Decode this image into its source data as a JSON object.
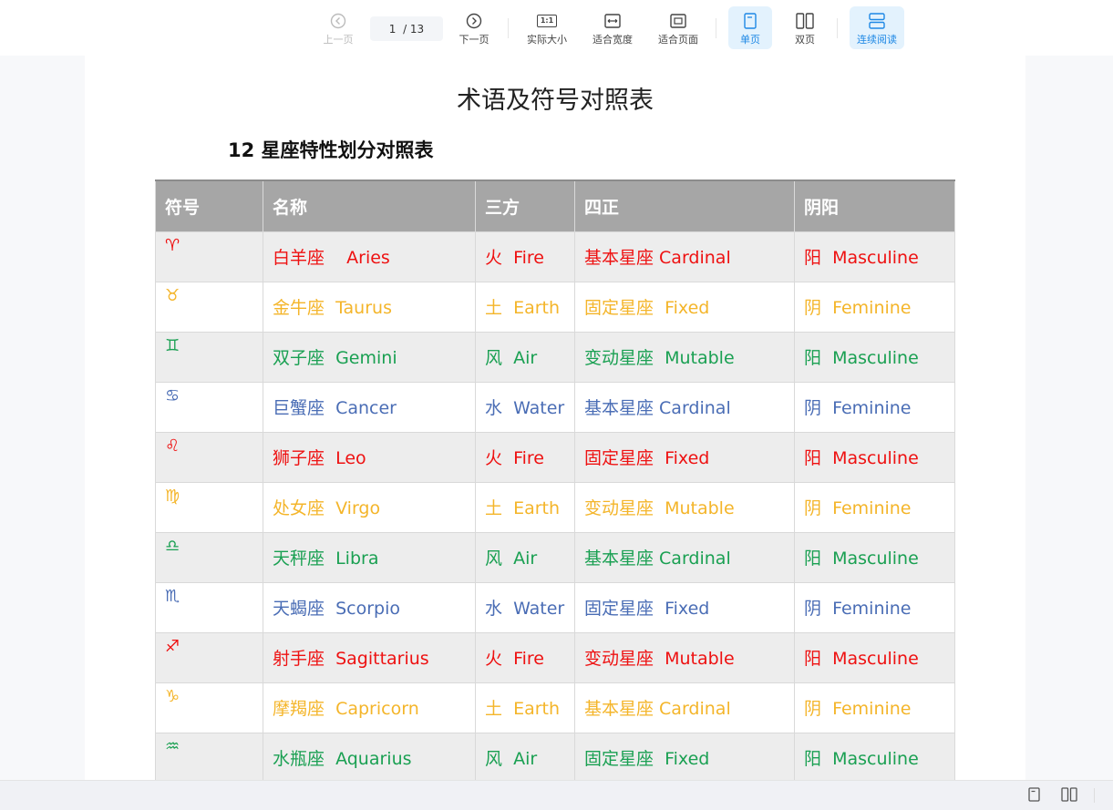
{
  "toolbar": {
    "prev_label": "上一页",
    "page_current": "1",
    "page_total": "/ 13",
    "next_label": "下一页",
    "actual_size_label": "实际大小",
    "actual_size_icon_text": "1:1",
    "fit_width_label": "适合宽度",
    "fit_page_label": "适合页面",
    "single_page_label": "单页",
    "double_page_label": "双页",
    "continuous_label": "连续阅读",
    "accent_color": "#1e88e5"
  },
  "document": {
    "title": "术语及符号对照表",
    "subtitle": "12 星座特性划分对照表",
    "table": {
      "headers": [
        "符号",
        "名称",
        "三方",
        "四正",
        "阴阳"
      ],
      "rows": [
        {
          "symbol": "♈",
          "name": "白羊座    Aries",
          "triplicity": "火  Fire",
          "quadruplicity": "基本星座 Cardinal",
          "polarity": "阳  Masculine",
          "color": "#ee1111"
        },
        {
          "symbol": "♉",
          "name": "金牛座  Taurus",
          "triplicity": "土  Earth",
          "quadruplicity": "固定星座  Fixed",
          "polarity": "阴  Feminine",
          "color": "#f4b52a"
        },
        {
          "symbol": "♊",
          "name": "双子座  Gemini",
          "triplicity": "风  Air",
          "quadruplicity": "变动星座  Mutable",
          "polarity": "阳  Masculine",
          "color": "#1aa052"
        },
        {
          "symbol": "♋",
          "name": "巨蟹座  Cancer",
          "triplicity": "水  Water",
          "quadruplicity": "基本星座 Cardinal",
          "polarity": "阴  Feminine",
          "color": "#4a6db5"
        },
        {
          "symbol": "♌",
          "name": "狮子座  Leo",
          "triplicity": "火  Fire",
          "quadruplicity": "固定星座  Fixed",
          "polarity": "阳  Masculine",
          "color": "#ee1111"
        },
        {
          "symbol": "♍",
          "name": "处女座  Virgo",
          "triplicity": "土  Earth",
          "quadruplicity": "变动星座  Mutable",
          "polarity": "阴  Feminine",
          "color": "#f4b52a"
        },
        {
          "symbol": "♎",
          "name": "天秤座  Libra",
          "triplicity": "风  Air",
          "quadruplicity": "基本星座 Cardinal",
          "polarity": "阳  Masculine",
          "color": "#1aa052"
        },
        {
          "symbol": "♏",
          "name": "天蝎座  Scorpio",
          "triplicity": "水  Water",
          "quadruplicity": "固定星座  Fixed",
          "polarity": "阴  Feminine",
          "color": "#4a6db5"
        },
        {
          "symbol": "♐",
          "name": "射手座  Sagittarius",
          "triplicity": "火  Fire",
          "quadruplicity": "变动星座  Mutable",
          "polarity": "阳  Masculine",
          "color": "#ee1111"
        },
        {
          "symbol": "♑",
          "name": "摩羯座  Capricorn",
          "triplicity": "土  Earth",
          "quadruplicity": "基本星座 Cardinal",
          "polarity": "阴  Feminine",
          "color": "#f4b52a"
        },
        {
          "symbol": "♒",
          "name": "水瓶座  Aquarius",
          "triplicity": "风  Air",
          "quadruplicity": "固定星座  Fixed",
          "polarity": "阳  Masculine",
          "color": "#1aa052"
        }
      ]
    }
  },
  "statusbar": {
    "icons": [
      "single-page-icon",
      "double-page-icon"
    ]
  }
}
